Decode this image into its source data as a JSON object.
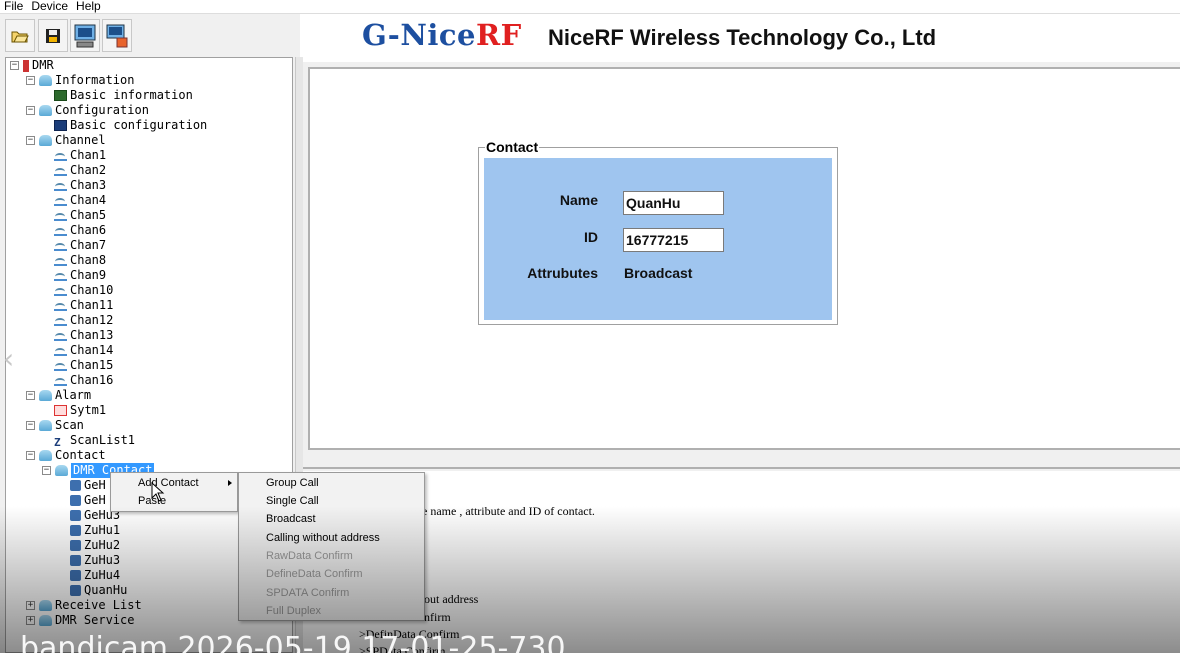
{
  "menubar": {
    "file": "File",
    "device": "Device",
    "help": "Help"
  },
  "toolbar": {
    "open_icon": "open-folder-icon",
    "save_icon": "save-disk-icon",
    "read_icon": "read-device-icon",
    "write_icon": "write-device-icon"
  },
  "banner": {
    "logo_prefix": "G-Nice",
    "logo_suffix": "RF",
    "company": "NiceRF Wireless Technology Co., Ltd",
    "logo_blue": "#1d4fa0",
    "logo_red": "#e02020"
  },
  "tree": {
    "root": "DMR",
    "information": "Information",
    "basic_information": "Basic information",
    "configuration": "Configuration",
    "basic_configuration": "Basic configuration",
    "channel": "Channel",
    "channels": [
      "Chan1",
      "Chan2",
      "Chan3",
      "Chan4",
      "Chan5",
      "Chan6",
      "Chan7",
      "Chan8",
      "Chan9",
      "Chan10",
      "Chan11",
      "Chan12",
      "Chan13",
      "Chan14",
      "Chan15",
      "Chan16"
    ],
    "alarm": "Alarm",
    "sytm1": "Sytm1",
    "scan": "Scan",
    "scanlist1": "ScanList1",
    "contact": "Contact",
    "dmr_contact": "DMR Contact",
    "contacts": [
      "GeH",
      "GeH",
      "GeHu3",
      "ZuHu1",
      "ZuHu2",
      "ZuHu3",
      "ZuHu4",
      "QuanHu"
    ],
    "receive_list": "Receive List",
    "dmr_service": "DMR Service"
  },
  "contact_form": {
    "title": "Contact",
    "name_label": "Name",
    "name_value": "QuanHu",
    "id_label": "ID",
    "id_value": "16777215",
    "attr_label": "Attrubutes",
    "attr_value": "Broadcast",
    "panel_color": "#9fc5ef"
  },
  "help": {
    "line1": "e name , attribute and ID of contact.",
    "line2": "out address",
    "line3": "nfirm",
    "line4": ">DefinData Confirm",
    "line5": ">SPData Confirm"
  },
  "context_menu": {
    "add_contact": "Add Contact",
    "paste": "Paste"
  },
  "submenu": {
    "items": [
      {
        "label": "Group Call",
        "enabled": true
      },
      {
        "label": "Single Call",
        "enabled": true
      },
      {
        "label": "Broadcast",
        "enabled": true
      },
      {
        "label": "Calling without address",
        "enabled": true
      },
      {
        "label": "RawData Confirm",
        "enabled": false
      },
      {
        "label": "DefineData Confirm",
        "enabled": false
      },
      {
        "label": "SPDATA Confirm",
        "enabled": false
      },
      {
        "label": "Full Duplex",
        "enabled": false
      }
    ]
  },
  "watermark": "bandicam 2026-05-19 17-01-25-730"
}
